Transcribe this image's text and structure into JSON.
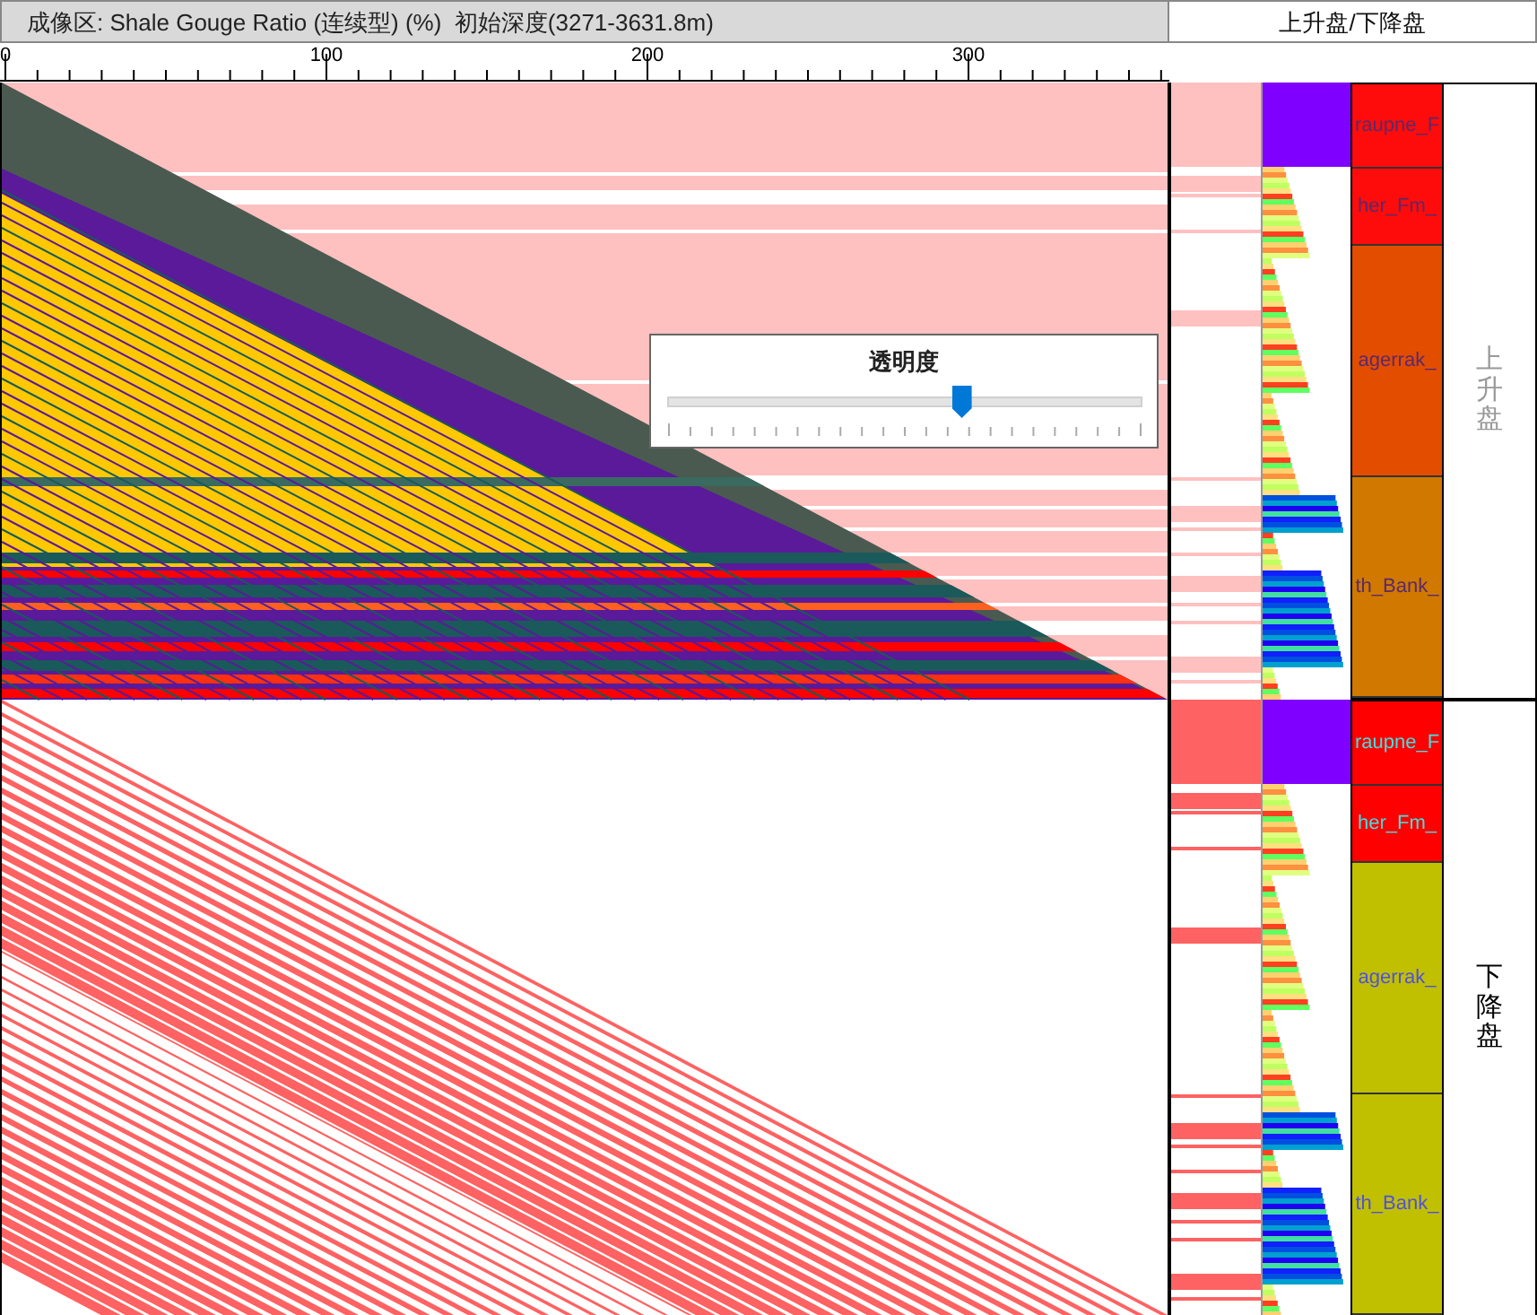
{
  "title_bar": {
    "text": "成像区: Shale Gouge Ratio (连续型) (%)  初始深度(3271-3631.8m)"
  },
  "side_header": {
    "text": "上升盘/下降盘"
  },
  "axis": {
    "ticks": [
      "0",
      "100",
      "200",
      "300"
    ]
  },
  "slider": {
    "title": "透明度",
    "level": 0.62
  },
  "blocks": [
    {
      "label": "上升盘",
      "faded": true,
      "formations": [
        {
          "name": "raupne_F",
          "color": "#fe0c0c"
        },
        {
          "name": "her_Fm_",
          "color": "#fe0c0c"
        },
        {
          "name": "agerrak_",
          "color": "#e34d00"
        },
        {
          "name": "th_Bank_",
          "color": "#d07800"
        }
      ]
    },
    {
      "label": "下降盘",
      "faded": false,
      "formations": [
        {
          "name": "raupne_F",
          "color": "#ff0000"
        },
        {
          "name": "her_Fm_",
          "color": "#ff0000"
        },
        {
          "name": "agerrak_",
          "color": "#c0c000"
        },
        {
          "name": "th_Bank_",
          "color": "#c0c000"
        }
      ]
    }
  ]
}
